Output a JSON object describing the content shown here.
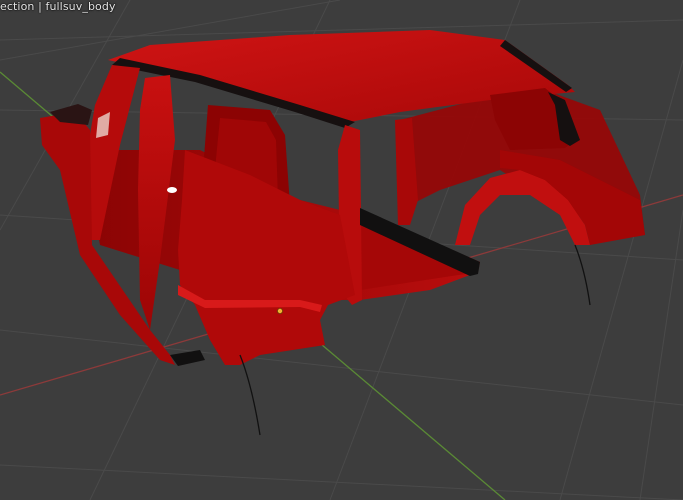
{
  "viewport": {
    "overlay_text": "ection | fullsuv_body"
  },
  "colors": {
    "background": "#3d3d3d",
    "grid_line": "#4a4a4a",
    "x_axis": "#8c3a3a",
    "y_axis": "#5a8a35",
    "body_red": "#c00a0a",
    "body_dark": "#7a0000",
    "body_shadow": "#140404",
    "origin_point": "#f2b233"
  },
  "icons": [
    "origin-point-icon"
  ]
}
